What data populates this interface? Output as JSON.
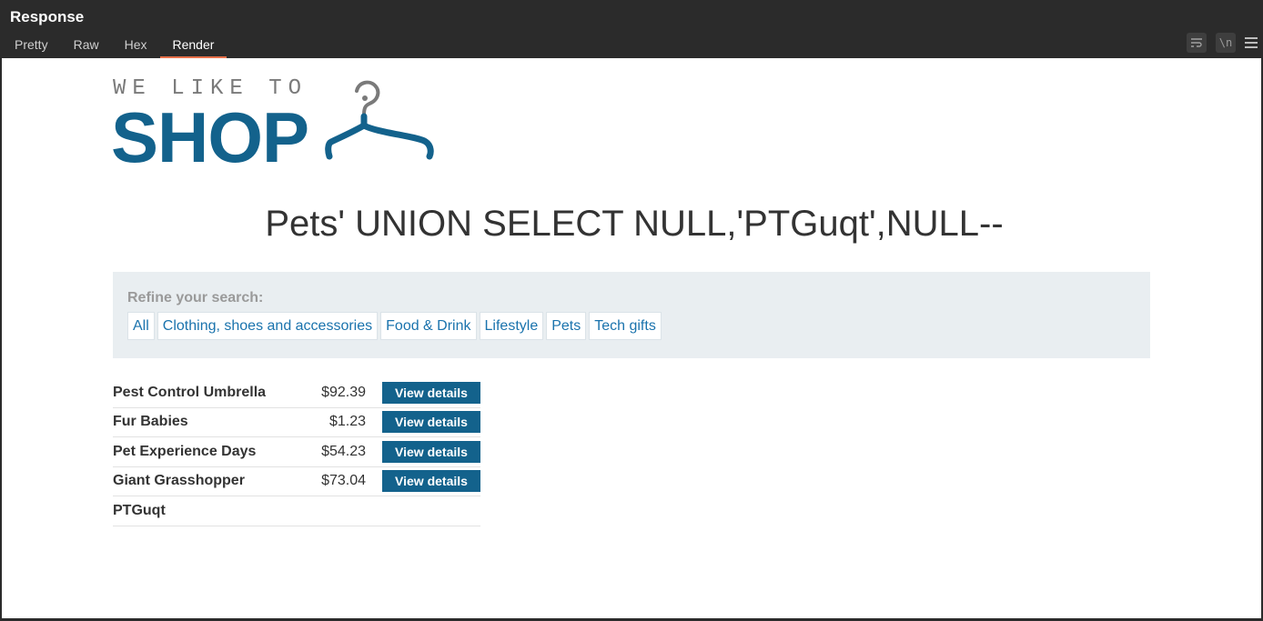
{
  "panel": {
    "title": "Response",
    "tabs": [
      {
        "label": "Pretty",
        "active": false
      },
      {
        "label": "Raw",
        "active": false
      },
      {
        "label": "Hex",
        "active": false
      },
      {
        "label": "Render",
        "active": true
      }
    ],
    "tools": {
      "wrap_icon": "wrap-lines-icon",
      "newline_label": "\\n",
      "menu_icon": "hamburger-menu-icon"
    }
  },
  "logo": {
    "small": "WE LIKE TO",
    "big": "SHOP",
    "icon": "hanger-icon",
    "color": "#13628c"
  },
  "search": {
    "title": "Pets' UNION SELECT NULL,'PTGuqt',NULL--"
  },
  "filters": {
    "label": "Refine your search:",
    "items": [
      "All",
      "Clothing, shoes and accessories",
      "Food & Drink",
      "Lifestyle",
      "Pets",
      "Tech gifts"
    ]
  },
  "products": [
    {
      "name": "Pest Control Umbrella",
      "price": "$92.39",
      "button": "View details"
    },
    {
      "name": "Fur Babies",
      "price": "$1.23",
      "button": "View details"
    },
    {
      "name": "Pet Experience Days",
      "price": "$54.23",
      "button": "View details"
    },
    {
      "name": "Giant Grasshopper",
      "price": "$73.04",
      "button": "View details"
    },
    {
      "name": "PTGuqt",
      "price": "",
      "button": ""
    }
  ],
  "colors": {
    "accent_tab": "#e8704a",
    "brand": "#13628c",
    "link": "#1a73ad",
    "filter_bg": "#e9eef1"
  }
}
